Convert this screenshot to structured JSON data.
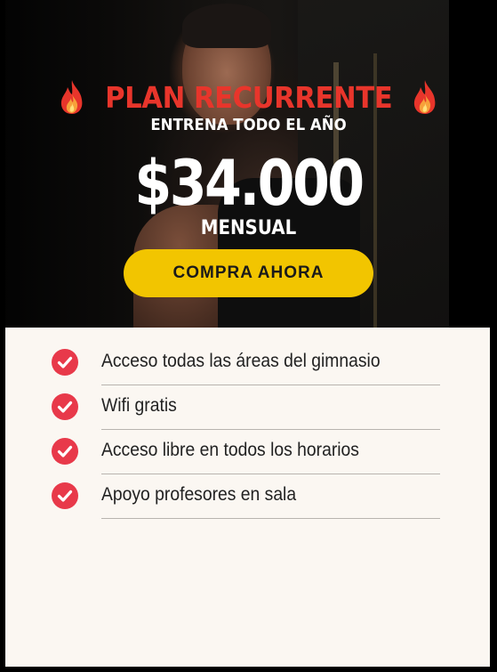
{
  "plan": {
    "title": "PLAN RECURRENTE",
    "subtitle": "ENTRENA TODO EL AÑO",
    "price": "$34.000",
    "period": "MENSUAL",
    "cta_label": "COMPRA AHORA",
    "title_icon": "fire-icon",
    "check_icon": "check-circle-icon"
  },
  "features": [
    {
      "label": "Acceso todas las áreas del gimnasio"
    },
    {
      "label": "Wifi gratis"
    },
    {
      "label": "Acceso libre en todos los horarios"
    },
    {
      "label": "Apoyo profesores en sala"
    }
  ],
  "colors": {
    "title_red": "#e8352b",
    "button_yellow": "#f2c500",
    "check_red": "#e8394a",
    "panel_bg": "#fbf7f2"
  }
}
